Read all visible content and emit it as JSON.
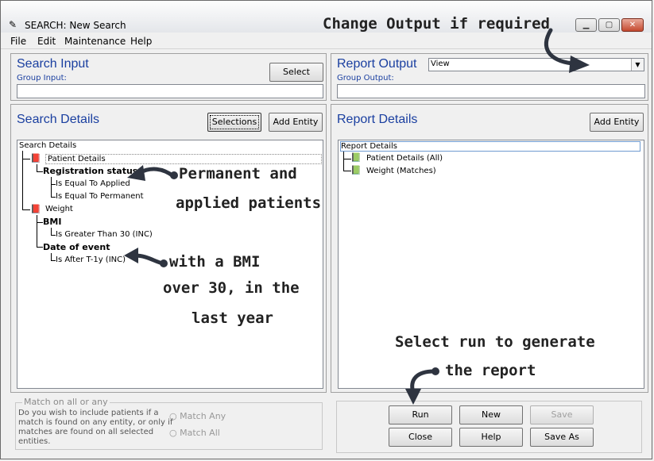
{
  "window": {
    "title": "SEARCH: New Search"
  },
  "menu": {
    "items": [
      "File",
      "Edit",
      "Maintenance",
      "Help"
    ]
  },
  "search_input": {
    "title": "Search Input",
    "sub_label": "Group Input:",
    "select_button": "Select"
  },
  "report_output": {
    "title": "Report Output",
    "sub_label": "Group Output:",
    "dropdown_value": "View"
  },
  "search_details": {
    "title": "Search Details",
    "selections_button": "Selections",
    "add_entity_button": "Add Entity",
    "tree": {
      "root": "Search Details",
      "patient_details": "Patient Details",
      "registration_status": "Registration status",
      "equal_applied": "Is Equal To Applied",
      "equal_permanent": "Is Equal To Permanent",
      "weight": "Weight",
      "bmi": "BMI",
      "bmi_condition": "Is Greater Than 30 (INC)",
      "date_of_event": "Date of event",
      "date_condition": "Is After T-1y (INC)"
    }
  },
  "report_details": {
    "title": "Report Details",
    "add_entity_button": "Add Entity",
    "tree": {
      "root": "Report Details",
      "patient_details": "Patient Details (All)",
      "weight": "Weight (Matches)"
    }
  },
  "match": {
    "legend": "Match on all or any",
    "description_lines": [
      "Do you wish to include patients if a",
      "match is found on any entity, or only if",
      "matches are found on all selected",
      "entities."
    ],
    "option_any": "Match Any",
    "option_all": "Match All"
  },
  "actions": {
    "run": "Run",
    "new": "New",
    "save": "Save",
    "close": "Close",
    "help": "Help",
    "save_as": "Save As"
  },
  "annotations": {
    "change_output": "Change Output if required",
    "permanent_line1": "Permanent and",
    "permanent_line2": "applied patients",
    "bmi_line1": "with a BMI",
    "bmi_line2": "over 30, in the",
    "bmi_line3": "last year",
    "run_line1": "Select run to generate",
    "run_line2": "the report"
  },
  "colors": {
    "heading_blue": "#1a3fa0",
    "close_red": "#c4492f"
  }
}
